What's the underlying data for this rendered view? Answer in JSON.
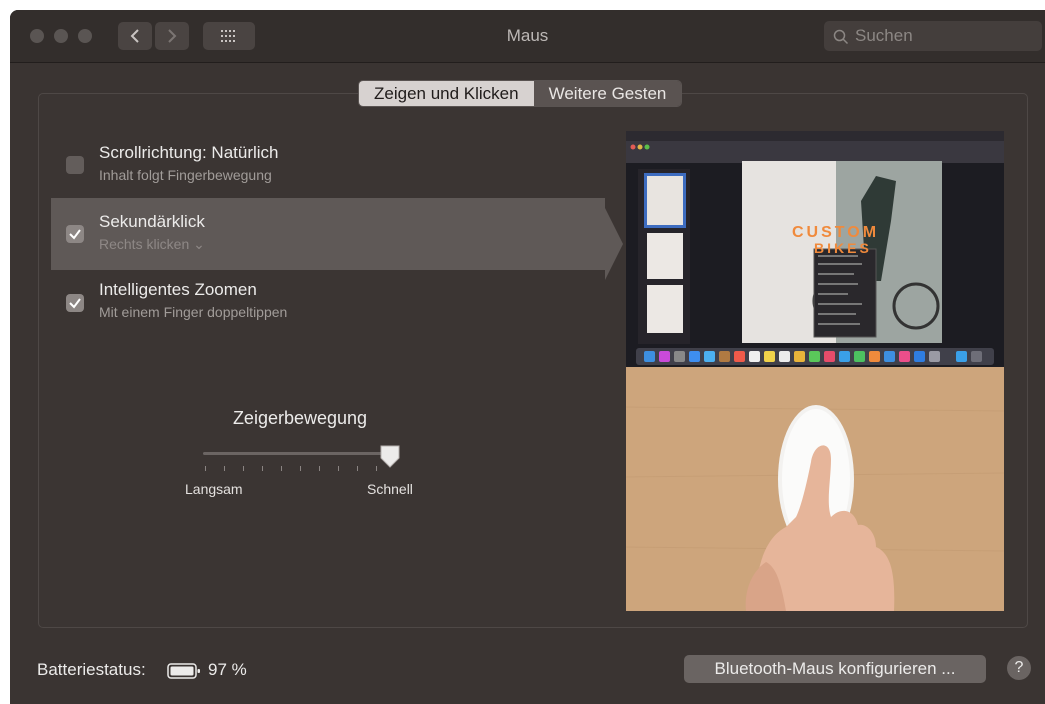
{
  "window": {
    "title": "Maus"
  },
  "search": {
    "placeholder": "Suchen"
  },
  "tabs": [
    {
      "label": "Zeigen und Klicken",
      "active": true
    },
    {
      "label": "Weitere Gesten",
      "active": false
    }
  ],
  "options": [
    {
      "title": "Scrollrichtung: Natürlich",
      "subtitle": "Inhalt folgt Fingerbewegung",
      "checked": false
    },
    {
      "title": "Sekundärklick",
      "subtitle": "Rechts klicken ⌄",
      "checked": true
    },
    {
      "title": "Intelligentes Zoomen",
      "subtitle": "Mit einem Finger doppeltippen",
      "checked": true
    }
  ],
  "tracking": {
    "label": "Zeigerbewegung",
    "min_label": "Langsam",
    "max_label": "Schnell",
    "value_fraction": 0.95
  },
  "preview": {
    "headline": "CUSTOM BIKES"
  },
  "footer": {
    "battery_label": "Batteriestatus:",
    "battery_value": "97 %",
    "configure_button": "Bluetooth-Maus konfigurieren ...",
    "help_label": "?"
  },
  "colors": {
    "window_bg": "#3a3432",
    "selected_row": "#5f5957",
    "active_tab": "#d7d2d0"
  }
}
